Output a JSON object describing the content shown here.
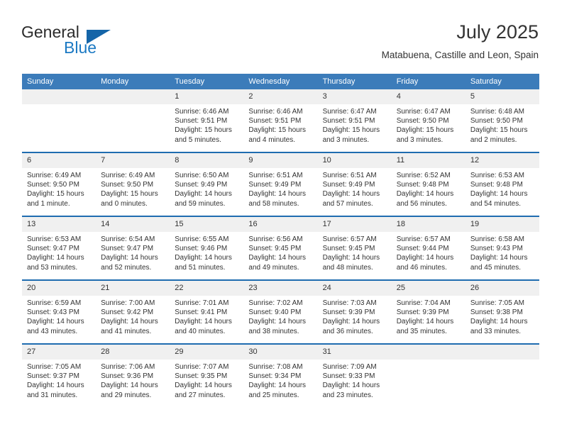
{
  "brand": {
    "name_part1": "General",
    "name_part2": "Blue",
    "accent_color": "#1b79c3",
    "triangle_color": "#1565a8"
  },
  "header": {
    "title": "July 2025",
    "subtitle": "Matabuena, Castille and Leon, Spain"
  },
  "theme": {
    "header_bg": "#3c7cba",
    "row_divider": "#1f6cb0",
    "daynum_bg": "#f0f0f0"
  },
  "weekdays": [
    "Sunday",
    "Monday",
    "Tuesday",
    "Wednesday",
    "Thursday",
    "Friday",
    "Saturday"
  ],
  "weeks": [
    [
      {
        "day": "",
        "sunrise": "",
        "sunset": "",
        "daylight1": "",
        "daylight2": ""
      },
      {
        "day": "",
        "sunrise": "",
        "sunset": "",
        "daylight1": "",
        "daylight2": ""
      },
      {
        "day": "1",
        "sunrise": "Sunrise: 6:46 AM",
        "sunset": "Sunset: 9:51 PM",
        "daylight1": "Daylight: 15 hours",
        "daylight2": "and 5 minutes."
      },
      {
        "day": "2",
        "sunrise": "Sunrise: 6:46 AM",
        "sunset": "Sunset: 9:51 PM",
        "daylight1": "Daylight: 15 hours",
        "daylight2": "and 4 minutes."
      },
      {
        "day": "3",
        "sunrise": "Sunrise: 6:47 AM",
        "sunset": "Sunset: 9:51 PM",
        "daylight1": "Daylight: 15 hours",
        "daylight2": "and 3 minutes."
      },
      {
        "day": "4",
        "sunrise": "Sunrise: 6:47 AM",
        "sunset": "Sunset: 9:50 PM",
        "daylight1": "Daylight: 15 hours",
        "daylight2": "and 3 minutes."
      },
      {
        "day": "5",
        "sunrise": "Sunrise: 6:48 AM",
        "sunset": "Sunset: 9:50 PM",
        "daylight1": "Daylight: 15 hours",
        "daylight2": "and 2 minutes."
      }
    ],
    [
      {
        "day": "6",
        "sunrise": "Sunrise: 6:49 AM",
        "sunset": "Sunset: 9:50 PM",
        "daylight1": "Daylight: 15 hours",
        "daylight2": "and 1 minute."
      },
      {
        "day": "7",
        "sunrise": "Sunrise: 6:49 AM",
        "sunset": "Sunset: 9:50 PM",
        "daylight1": "Daylight: 15 hours",
        "daylight2": "and 0 minutes."
      },
      {
        "day": "8",
        "sunrise": "Sunrise: 6:50 AM",
        "sunset": "Sunset: 9:49 PM",
        "daylight1": "Daylight: 14 hours",
        "daylight2": "and 59 minutes."
      },
      {
        "day": "9",
        "sunrise": "Sunrise: 6:51 AM",
        "sunset": "Sunset: 9:49 PM",
        "daylight1": "Daylight: 14 hours",
        "daylight2": "and 58 minutes."
      },
      {
        "day": "10",
        "sunrise": "Sunrise: 6:51 AM",
        "sunset": "Sunset: 9:49 PM",
        "daylight1": "Daylight: 14 hours",
        "daylight2": "and 57 minutes."
      },
      {
        "day": "11",
        "sunrise": "Sunrise: 6:52 AM",
        "sunset": "Sunset: 9:48 PM",
        "daylight1": "Daylight: 14 hours",
        "daylight2": "and 56 minutes."
      },
      {
        "day": "12",
        "sunrise": "Sunrise: 6:53 AM",
        "sunset": "Sunset: 9:48 PM",
        "daylight1": "Daylight: 14 hours",
        "daylight2": "and 54 minutes."
      }
    ],
    [
      {
        "day": "13",
        "sunrise": "Sunrise: 6:53 AM",
        "sunset": "Sunset: 9:47 PM",
        "daylight1": "Daylight: 14 hours",
        "daylight2": "and 53 minutes."
      },
      {
        "day": "14",
        "sunrise": "Sunrise: 6:54 AM",
        "sunset": "Sunset: 9:47 PM",
        "daylight1": "Daylight: 14 hours",
        "daylight2": "and 52 minutes."
      },
      {
        "day": "15",
        "sunrise": "Sunrise: 6:55 AM",
        "sunset": "Sunset: 9:46 PM",
        "daylight1": "Daylight: 14 hours",
        "daylight2": "and 51 minutes."
      },
      {
        "day": "16",
        "sunrise": "Sunrise: 6:56 AM",
        "sunset": "Sunset: 9:45 PM",
        "daylight1": "Daylight: 14 hours",
        "daylight2": "and 49 minutes."
      },
      {
        "day": "17",
        "sunrise": "Sunrise: 6:57 AM",
        "sunset": "Sunset: 9:45 PM",
        "daylight1": "Daylight: 14 hours",
        "daylight2": "and 48 minutes."
      },
      {
        "day": "18",
        "sunrise": "Sunrise: 6:57 AM",
        "sunset": "Sunset: 9:44 PM",
        "daylight1": "Daylight: 14 hours",
        "daylight2": "and 46 minutes."
      },
      {
        "day": "19",
        "sunrise": "Sunrise: 6:58 AM",
        "sunset": "Sunset: 9:43 PM",
        "daylight1": "Daylight: 14 hours",
        "daylight2": "and 45 minutes."
      }
    ],
    [
      {
        "day": "20",
        "sunrise": "Sunrise: 6:59 AM",
        "sunset": "Sunset: 9:43 PM",
        "daylight1": "Daylight: 14 hours",
        "daylight2": "and 43 minutes."
      },
      {
        "day": "21",
        "sunrise": "Sunrise: 7:00 AM",
        "sunset": "Sunset: 9:42 PM",
        "daylight1": "Daylight: 14 hours",
        "daylight2": "and 41 minutes."
      },
      {
        "day": "22",
        "sunrise": "Sunrise: 7:01 AM",
        "sunset": "Sunset: 9:41 PM",
        "daylight1": "Daylight: 14 hours",
        "daylight2": "and 40 minutes."
      },
      {
        "day": "23",
        "sunrise": "Sunrise: 7:02 AM",
        "sunset": "Sunset: 9:40 PM",
        "daylight1": "Daylight: 14 hours",
        "daylight2": "and 38 minutes."
      },
      {
        "day": "24",
        "sunrise": "Sunrise: 7:03 AM",
        "sunset": "Sunset: 9:39 PM",
        "daylight1": "Daylight: 14 hours",
        "daylight2": "and 36 minutes."
      },
      {
        "day": "25",
        "sunrise": "Sunrise: 7:04 AM",
        "sunset": "Sunset: 9:39 PM",
        "daylight1": "Daylight: 14 hours",
        "daylight2": "and 35 minutes."
      },
      {
        "day": "26",
        "sunrise": "Sunrise: 7:05 AM",
        "sunset": "Sunset: 9:38 PM",
        "daylight1": "Daylight: 14 hours",
        "daylight2": "and 33 minutes."
      }
    ],
    [
      {
        "day": "27",
        "sunrise": "Sunrise: 7:05 AM",
        "sunset": "Sunset: 9:37 PM",
        "daylight1": "Daylight: 14 hours",
        "daylight2": "and 31 minutes."
      },
      {
        "day": "28",
        "sunrise": "Sunrise: 7:06 AM",
        "sunset": "Sunset: 9:36 PM",
        "daylight1": "Daylight: 14 hours",
        "daylight2": "and 29 minutes."
      },
      {
        "day": "29",
        "sunrise": "Sunrise: 7:07 AM",
        "sunset": "Sunset: 9:35 PM",
        "daylight1": "Daylight: 14 hours",
        "daylight2": "and 27 minutes."
      },
      {
        "day": "30",
        "sunrise": "Sunrise: 7:08 AM",
        "sunset": "Sunset: 9:34 PM",
        "daylight1": "Daylight: 14 hours",
        "daylight2": "and 25 minutes."
      },
      {
        "day": "31",
        "sunrise": "Sunrise: 7:09 AM",
        "sunset": "Sunset: 9:33 PM",
        "daylight1": "Daylight: 14 hours",
        "daylight2": "and 23 minutes."
      },
      {
        "day": "",
        "sunrise": "",
        "sunset": "",
        "daylight1": "",
        "daylight2": ""
      },
      {
        "day": "",
        "sunrise": "",
        "sunset": "",
        "daylight1": "",
        "daylight2": ""
      }
    ]
  ]
}
